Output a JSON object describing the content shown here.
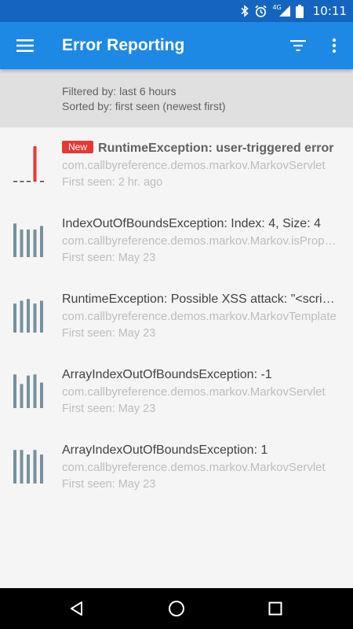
{
  "status_bar": {
    "time": "10:11",
    "network": "4G",
    "icons": [
      "bluetooth-icon",
      "alarm-icon",
      "signal-icon",
      "battery-icon"
    ]
  },
  "app_bar": {
    "title": "Error Reporting",
    "icons": [
      "menu-icon",
      "filter-icon",
      "overflow-menu-icon"
    ]
  },
  "filter_panel": {
    "filtered_by": "Filtered by: last 6 hours",
    "sorted_by": "Sorted by: first seen (newest first)"
  },
  "colors": {
    "status_bar": "#1565c0",
    "app_bar": "#1e88e5",
    "new_badge": "#e53935",
    "sparkline_bar": "#78909c",
    "sparkline_new_bar": "#e53935"
  },
  "errors": [
    {
      "is_new": true,
      "badge": "New",
      "title": "RuntimeException: user-triggered error",
      "class_name": "com.callbyreference.demos.markov.MarkovServlet",
      "first_seen": "First seen: 2 hr. ago",
      "spark": [
        0,
        0,
        0,
        1,
        0
      ]
    },
    {
      "is_new": false,
      "badge": "",
      "title": "IndexOutOfBoundsException: Index: 4, Size: 4",
      "class_name": "com.callbyreference.demos.markov.Markov.isProperNoun",
      "first_seen": "First seen: May 23",
      "spark": [
        0.95,
        0.78,
        0.78,
        0.78,
        0.88
      ]
    },
    {
      "is_new": false,
      "badge": "",
      "title": "RuntimeException: Possible XSS attack: \"<script>\"",
      "class_name": "com.callbyreference.demos.markov.MarkovTemplate",
      "first_seen": "First seen: May 23",
      "spark": [
        0.82,
        0.9,
        0.95,
        0.82,
        0.9
      ]
    },
    {
      "is_new": false,
      "badge": "",
      "title": "ArrayIndexOutOfBoundsException: -1",
      "class_name": "com.callbyreference.demos.markov.MarkovServlet",
      "first_seen": "First seen: May 23",
      "spark": [
        0.95,
        0.68,
        0.92,
        0.95,
        0.72
      ]
    },
    {
      "is_new": false,
      "badge": "",
      "title": "ArrayIndexOutOfBoundsException: 1",
      "class_name": "com.callbyreference.demos.markov.MarkovServlet",
      "first_seen": "First seen: May 23",
      "spark": [
        0.95,
        0.95,
        0.82,
        0.95,
        0.82
      ]
    }
  ],
  "nav_bar": {
    "icons": [
      "back-icon",
      "home-icon",
      "recents-icon"
    ]
  }
}
